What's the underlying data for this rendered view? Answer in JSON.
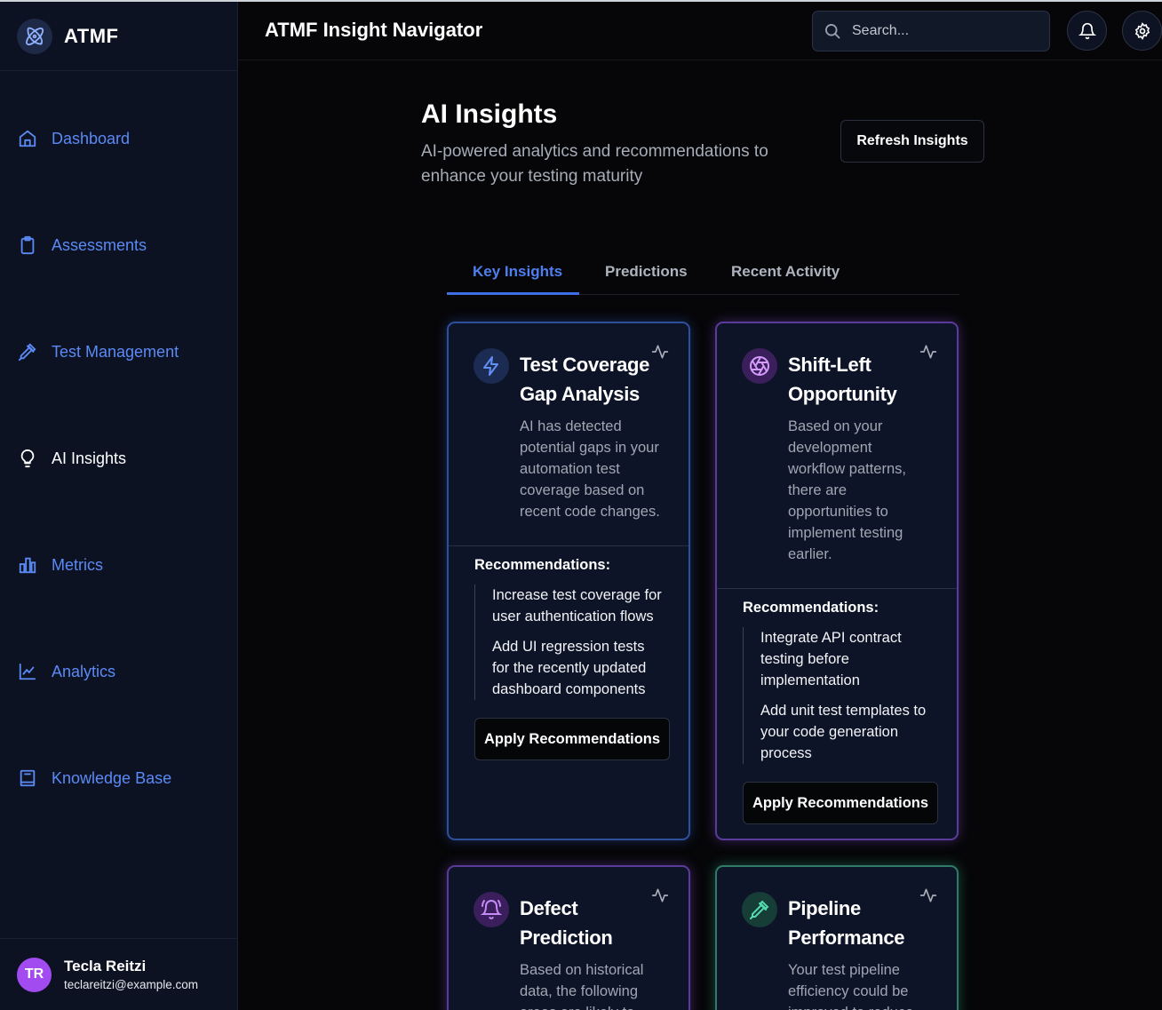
{
  "brand": {
    "name": "ATMF",
    "logo_icon": "atom-icon"
  },
  "sidebar": {
    "items": [
      {
        "label": "Dashboard",
        "icon": "home-icon"
      },
      {
        "label": "Assessments",
        "icon": "clipboard-icon"
      },
      {
        "label": "Test Management",
        "icon": "pipette-icon"
      },
      {
        "label": "AI Insights",
        "icon": "lightbulb-icon",
        "active": true
      },
      {
        "label": "Metrics",
        "icon": "bar-chart-icon"
      },
      {
        "label": "Analytics",
        "icon": "line-chart-icon"
      },
      {
        "label": "Knowledge Base",
        "icon": "book-icon"
      }
    ],
    "user": {
      "initials": "TR",
      "name": "Tecla Reitzi",
      "email": "teclareitzi@example.com"
    }
  },
  "header": {
    "title": "ATMF Insight Navigator",
    "search_placeholder": "Search..."
  },
  "page": {
    "title": "AI Insights",
    "subtitle": "AI-powered analytics and recommendations to enhance your testing maturity",
    "refresh_label": "Refresh Insights"
  },
  "tabs": [
    {
      "label": "Key Insights",
      "active": true
    },
    {
      "label": "Predictions"
    },
    {
      "label": "Recent Activity"
    }
  ],
  "cards": [
    {
      "title": "Test Coverage Gap Analysis",
      "description": "AI has detected potential gaps in your automation test coverage based on recent code changes.",
      "recommendations_title": "Recommendations:",
      "recommendations": [
        "Increase test coverage for user authentication flows",
        "Add UI regression tests for the recently updated dashboard components"
      ],
      "button": "Apply Recommendations",
      "icon": "lightning-icon",
      "accent": "#4f7ff0"
    },
    {
      "title": "Shift-Left Opportunity",
      "description": "Based on your development workflow patterns, there are opportunities to implement testing earlier.",
      "recommendations_title": "Recommendations:",
      "recommendations": [
        "Integrate API contract testing before implementation",
        "Add unit test templates to your code generation process"
      ],
      "button": "Apply Recommendations",
      "icon": "aperture-icon",
      "accent": "#c084fc"
    },
    {
      "title": "Defect Prediction",
      "description": "Based on historical data, the following areas are likely to",
      "icon": "bell-icon",
      "accent": "#b77cf5"
    },
    {
      "title": "Pipeline Performance",
      "description": "Your test pipeline efficiency could be improved to reduce",
      "icon": "pipette-icon",
      "accent": "#49d3a8"
    }
  ]
}
